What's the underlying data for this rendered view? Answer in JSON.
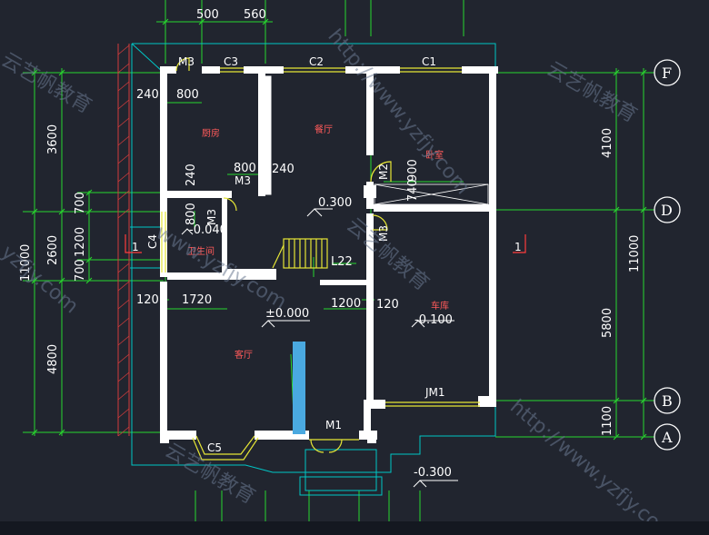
{
  "drawing": {
    "top_dims": [
      "500",
      "560"
    ],
    "left_dims": [
      "3600",
      "2600",
      "700",
      "1200",
      "700",
      "11000",
      "4800"
    ],
    "right_dims": [
      "4100",
      "11000",
      "5800",
      "1100"
    ],
    "axes": [
      "F",
      "D",
      "B",
      "A"
    ],
    "interior_dims": [
      "240",
      "800",
      "240",
      "800",
      "240",
      "800",
      "120",
      "1720",
      "1200",
      "120",
      "740",
      "900",
      "L22"
    ],
    "openings": [
      "M3",
      "C3",
      "C2",
      "C1",
      "M3",
      "M3",
      "M2",
      "M3",
      "C4",
      "JM1",
      "C5",
      "M1"
    ],
    "levels": [
      "0.300",
      "-0.040",
      "±0.000",
      "-0.100",
      "-0.300"
    ],
    "rooms": [
      "厨房",
      "餐厅",
      "卧室",
      "卫生间",
      "客厅",
      "车库"
    ],
    "section_marks": [
      "1",
      "1"
    ],
    "watermarks": [
      "云艺帆教育",
      "http://www.yzfjy.com",
      "www.yzfjy.com",
      "yzfjy.com",
      "云艺帆教育",
      "http://www.yzfjy.com",
      "云艺帆教育",
      "云艺帆教育"
    ],
    "colors": {
      "background": "#21252f",
      "wall": "#ffffff",
      "dimension": "#28d82f",
      "outline": "#00c6c6",
      "opening": "#e6e636",
      "section": "#ff3c3c",
      "room_label": "#ff5a5a"
    }
  }
}
